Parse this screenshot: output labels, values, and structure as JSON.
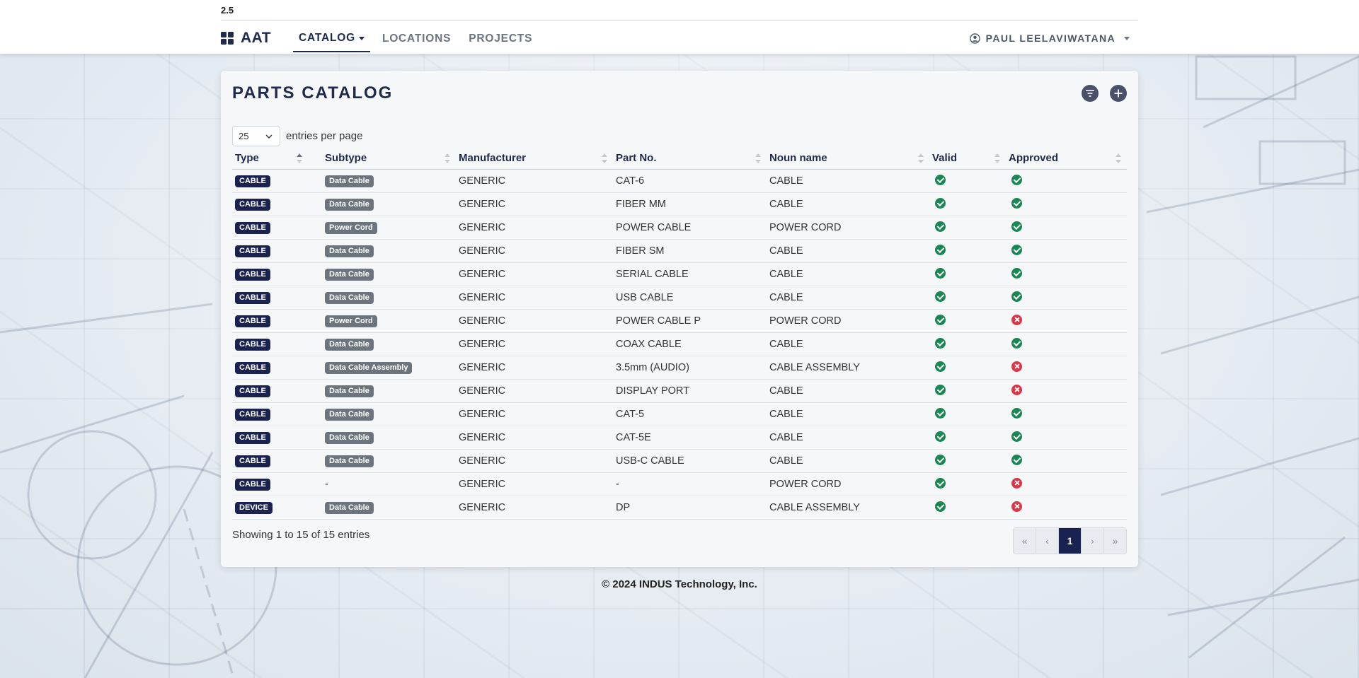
{
  "app": {
    "version": "2.5",
    "brand": "AAT",
    "nav": [
      {
        "label": "CATALOG",
        "active": true,
        "dropdown": true
      },
      {
        "label": "LOCATIONS",
        "active": false
      },
      {
        "label": "PROJECTS",
        "active": false
      }
    ],
    "user": "PAUL LEELAVIWATANA"
  },
  "catalog": {
    "title": "PARTS CATALOG",
    "page_length": "25",
    "page_length_label": "entries per page",
    "columns": [
      "Type",
      "Subtype",
      "Manufacturer",
      "Part No.",
      "Noun name",
      "Valid",
      "Approved"
    ],
    "rows": [
      {
        "type": "CABLE",
        "subtype": "Data Cable",
        "manufacturer": "GENERIC",
        "part_no": "CAT-6",
        "noun": "CABLE",
        "valid": true,
        "approved": true
      },
      {
        "type": "CABLE",
        "subtype": "Data Cable",
        "manufacturer": "GENERIC",
        "part_no": "FIBER MM",
        "noun": "CABLE",
        "valid": true,
        "approved": true
      },
      {
        "type": "CABLE",
        "subtype": "Power Cord",
        "manufacturer": "GENERIC",
        "part_no": "POWER CABLE",
        "noun": "POWER CORD",
        "valid": true,
        "approved": true
      },
      {
        "type": "CABLE",
        "subtype": "Data Cable",
        "manufacturer": "GENERIC",
        "part_no": "FIBER SM",
        "noun": "CABLE",
        "valid": true,
        "approved": true
      },
      {
        "type": "CABLE",
        "subtype": "Data Cable",
        "manufacturer": "GENERIC",
        "part_no": "SERIAL CABLE",
        "noun": "CABLE",
        "valid": true,
        "approved": true
      },
      {
        "type": "CABLE",
        "subtype": "Data Cable",
        "manufacturer": "GENERIC",
        "part_no": "USB CABLE",
        "noun": "CABLE",
        "valid": true,
        "approved": true
      },
      {
        "type": "CABLE",
        "subtype": "Power Cord",
        "manufacturer": "GENERIC",
        "part_no": "POWER CABLE P",
        "noun": "POWER CORD",
        "valid": true,
        "approved": false
      },
      {
        "type": "CABLE",
        "subtype": "Data Cable",
        "manufacturer": "GENERIC",
        "part_no": "COAX CABLE",
        "noun": "CABLE",
        "valid": true,
        "approved": true
      },
      {
        "type": "CABLE",
        "subtype": "Data Cable Assembly",
        "manufacturer": "GENERIC",
        "part_no": "3.5mm (AUDIO)",
        "noun": "CABLE ASSEMBLY",
        "valid": true,
        "approved": false
      },
      {
        "type": "CABLE",
        "subtype": "Data Cable",
        "manufacturer": "GENERIC",
        "part_no": "DISPLAY PORT",
        "noun": "CABLE",
        "valid": true,
        "approved": false
      },
      {
        "type": "CABLE",
        "subtype": "Data Cable",
        "manufacturer": "GENERIC",
        "part_no": "CAT-5",
        "noun": "CABLE",
        "valid": true,
        "approved": true
      },
      {
        "type": "CABLE",
        "subtype": "Data Cable",
        "manufacturer": "GENERIC",
        "part_no": "CAT-5E",
        "noun": "CABLE",
        "valid": true,
        "approved": true
      },
      {
        "type": "CABLE",
        "subtype": "Data Cable",
        "manufacturer": "GENERIC",
        "part_no": "USB-C CABLE",
        "noun": "CABLE",
        "valid": true,
        "approved": true
      },
      {
        "type": "CABLE",
        "subtype": "-",
        "manufacturer": "GENERIC",
        "part_no": "-",
        "noun": "POWER CORD",
        "valid": true,
        "approved": false
      },
      {
        "type": "DEVICE",
        "subtype": "Data Cable",
        "manufacturer": "GENERIC",
        "part_no": "DP",
        "noun": "CABLE ASSEMBLY",
        "valid": true,
        "approved": false
      }
    ],
    "info": "Showing 1 to 15 of 15 entries",
    "pagination": {
      "first": "«",
      "prev": "‹",
      "current": "1",
      "next": "›",
      "last": "»"
    }
  },
  "footer": "© 2024 INDUS Technology, Inc.",
  "icons": {
    "brand": "grid-icon",
    "user": "user-circle-icon",
    "filter": "filter-icon",
    "add": "plus-icon",
    "valid": "check-circle-icon",
    "invalid": "x-circle-icon"
  },
  "colors": {
    "brand": "#1a2250",
    "ok": "#198754",
    "error": "#dc3545",
    "subtype_badge": "#6c757d"
  }
}
